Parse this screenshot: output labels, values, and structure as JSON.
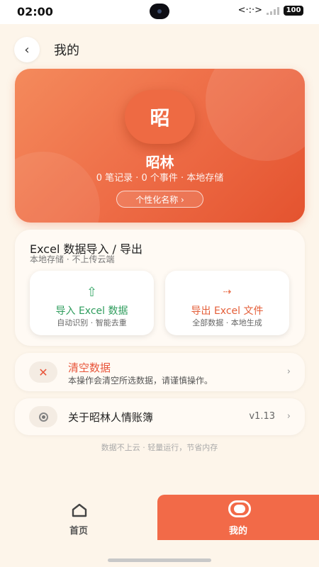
{
  "status_bar": {
    "time": "02:00",
    "network": "<·:·>",
    "battery": "100"
  },
  "header": {
    "back_icon": "‹",
    "title": "我的"
  },
  "profile": {
    "avatar_text": "昭",
    "name": "昭林",
    "stats": "0 笔记录 · 0 个事件 · 本地存储",
    "rename_label": "个性化名称 ›",
    "gradient_colors": [
      "#f48a5c",
      "#ee6d47",
      "#e4532f"
    ]
  },
  "excel": {
    "title": "Excel 数据导入 / 导出",
    "subtitle": "本地存储 · 不上传云端",
    "import": {
      "icon": "⇧",
      "label": "导入 Excel 数据",
      "sub": "自动识别 · 智能去重",
      "color": "#2e9c5c"
    },
    "export": {
      "icon": "⇢",
      "label": "导出 Excel 文件",
      "sub": "全部数据 · 本地生成",
      "color": "#e45e38"
    }
  },
  "clear_data": {
    "icon": "✕",
    "title": "清空数据",
    "description": "本操作会清空所选数据，请谨慎操作。",
    "chevron": "›"
  },
  "about": {
    "title": "关于昭林人情账簿",
    "version": "v1.13",
    "chevron": "›"
  },
  "footer_note": "数据不上云 · 轻量运行，节省内存",
  "tab_bar": {
    "home_label": "首页",
    "mine_label": "我的",
    "active_color": "#f26a48"
  }
}
